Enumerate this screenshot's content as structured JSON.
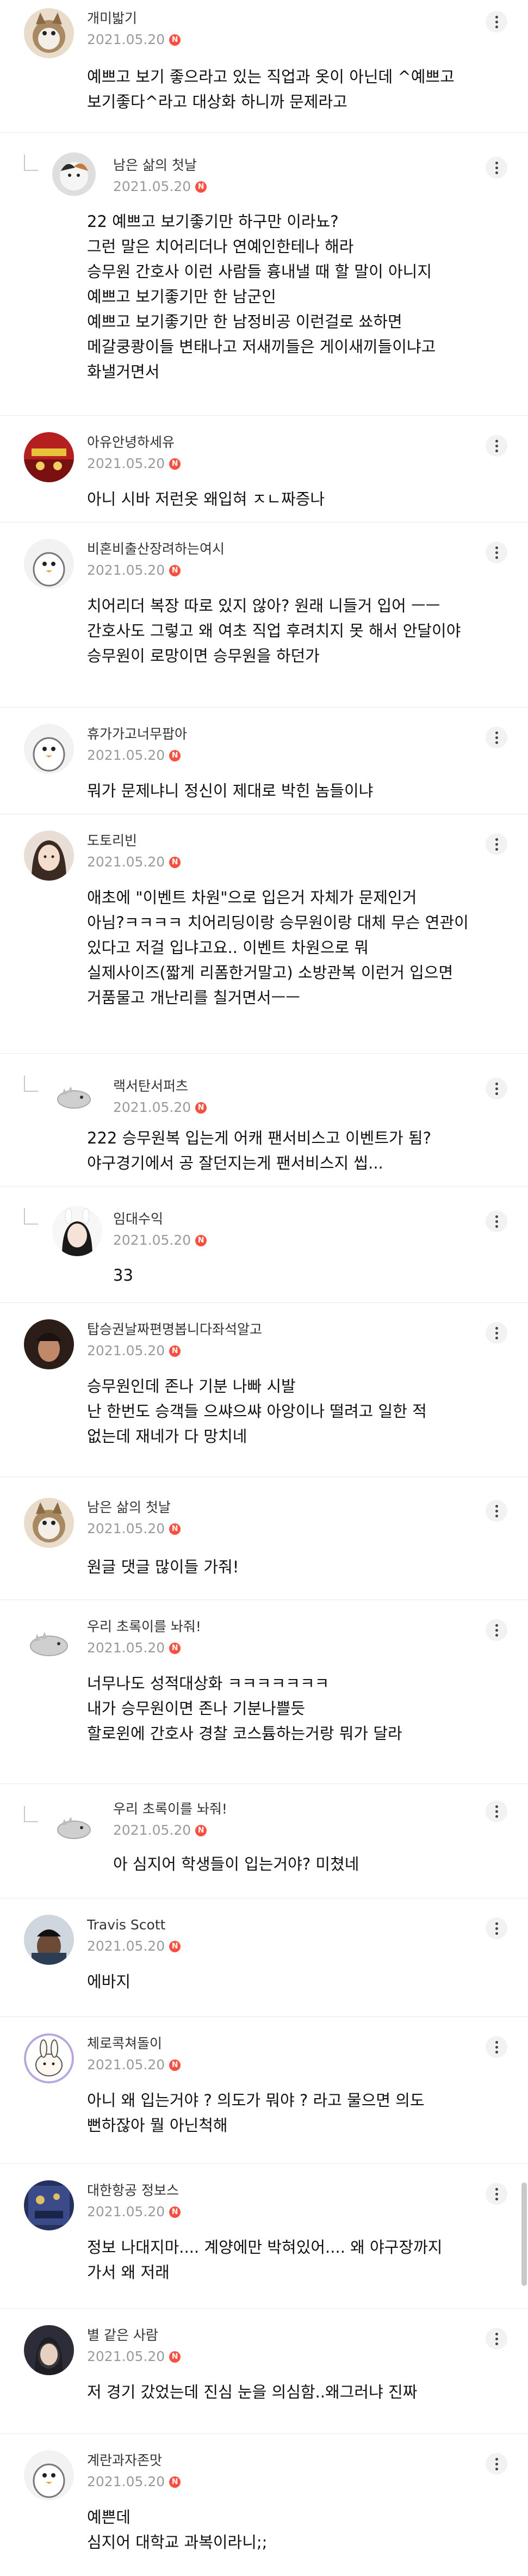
{
  "comments": [
    {
      "nick": "개미밟기",
      "date": "2021.05.20",
      "text": "예쁘고 보기 좋으라고 있는 직업과 옷이 아닌데 ^예쁘고\n보기좋다^라고 대상화 하니까 문제라고"
    },
    {
      "nick": "남은 삶의 첫날",
      "date": "2021.05.20",
      "text": "22 예쁘고 보기좋기만 하구만 이라뇨?\n그런 말은 치어리더나 연예인한테나 해라\n승무원 간호사 이런 사람들 흉내낼 때 할 말이 아니지\n예쁘고 보기좋기만 한 남군인\n예쁘고 보기좋기만 한 남정비공 이런걸로 쑈하면\n메갈쿵쾅이들 변태나고 저새끼들은 게이새끼들이냐고\n화낼거면서"
    },
    {
      "nick": "아유안녕하세유",
      "date": "2021.05.20",
      "text": "아니 시바 저런옷 왜입혀 ㅈㄴ짜증나"
    },
    {
      "nick": "비혼비출산장려하는여시",
      "date": "2021.05.20",
      "text": "치어리더 복장 따로 있지 않아? 원래 니들거 입어 ㅡㅡ\n간호사도 그렇고 왜 여초 직업 후려치지 못 해서 안달이야\n승무원이 로망이면 승무원을 하던가"
    },
    {
      "nick": "휴가가고너무팝아",
      "date": "2021.05.20",
      "text": "뭐가 문제냐니 정신이 제대로 박힌 놈들이냐"
    },
    {
      "nick": "도토리빈",
      "date": "2021.05.20",
      "text": "애초에 \"이벤트 차원\"으로 입은거 자체가 문제인거\n아님?ㅋㅋㅋㅋ 치어리딩이랑 승무원이랑 대체 무슨 연관이\n있다고 저걸 입냐고요.. 이벤트 차원으로 뭐\n실제사이즈(짧게 리폼한거말고) 소방관복 이런거 입으면\n거품물고 개난리를 칠거면서ㅡㅡ"
    },
    {
      "nick": "랙서탄서퍼츠",
      "date": "2021.05.20",
      "text": "222 승무원복 입는게 어캐 팬서비스고 이벤트가 됨?\n야구경기에서 공 잘던지는게 팬서비스지 씹..."
    },
    {
      "nick": "임대수익",
      "date": "2021.05.20",
      "text": "33"
    },
    {
      "nick": "탑승권날짜편명봅니다좌석알고",
      "date": "2021.05.20",
      "text": "승무원인데 존나 기분 나빠 시발\n난 한번도 승객들 으쌰으쌰 아앙이나 떨려고 일한 적\n없는데 재네가 다 망치네"
    },
    {
      "nick": "남은 삶의 첫날",
      "date": "2021.05.20",
      "text": "원글 댓글 많이들 가줘!"
    },
    {
      "nick": "우리 초록이를 놔줘!",
      "date": "2021.05.20",
      "text": "너무나도 성적대상화 ㅋㅋㅋㅋㅋㅋㅋ\n내가 승무원이면 존나 기분나쁠듯\n할로윈에 간호사 경찰 코스튬하는거랑 뭐가 달라"
    },
    {
      "nick": "우리 초록이를 놔줘!",
      "date": "2021.05.20",
      "text": "아 심지어 학생들이 입는거야? 미쳤네"
    },
    {
      "nick": "Travis Scott",
      "date": "2021.05.20",
      "text": "에바지"
    },
    {
      "nick": "체로콕쳐돌이",
      "date": "2021.05.20",
      "text": "아니 왜 입는거야 ? 의도가 뭐야 ? 라고 물으면 의도\n뻔하잖아 뭘 아닌척해"
    },
    {
      "nick": "대한항공 정보스",
      "date": "2021.05.20",
      "text": "정보 나대지마.... 계양에만 박혀있어.... 왜 야구장까지\n가서 왜 저래"
    },
    {
      "nick": "별 같은 사람",
      "date": "2021.05.20",
      "text": "저 경기 갔었는데 진심 눈을 의심함..왜그러냐 진짜"
    },
    {
      "nick": "계란과자존맛",
      "date": "2021.05.20",
      "text": "예쁜데\n심지어 대학교 과복이라니;;"
    }
  ],
  "new_badge": "N"
}
